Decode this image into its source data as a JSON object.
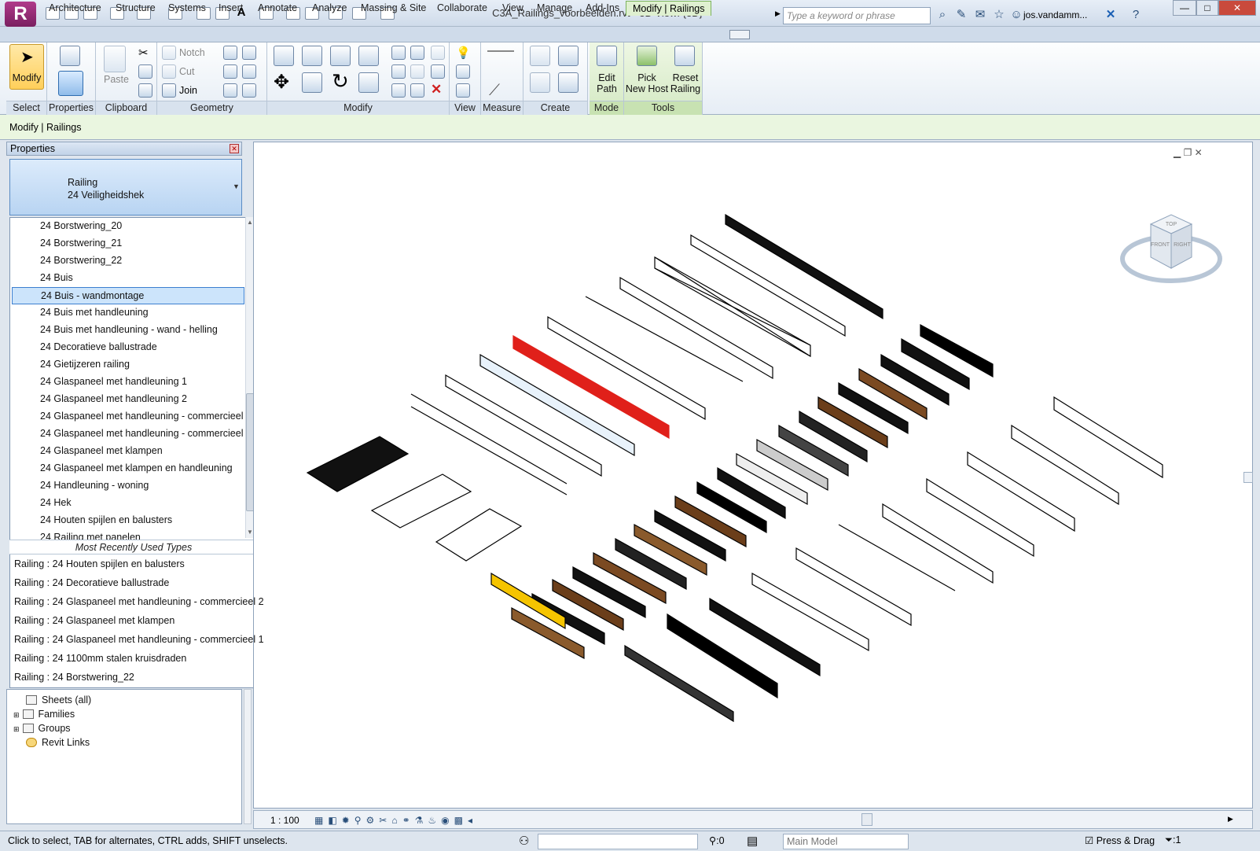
{
  "app": {
    "logo_letter": "R",
    "document_title": "C3A_Railings_voorbeelden.rvt - 3D View: {3D}",
    "search_placeholder": "Type a keyword or phrase",
    "username": "jos.vandamm..."
  },
  "tabs": [
    "Architecture",
    "Structure",
    "Systems",
    "Insert",
    "Annotate",
    "Analyze",
    "Massing & Site",
    "Collaborate",
    "View",
    "Manage",
    "Add-Ins",
    "Modify | Railings"
  ],
  "active_tab": "Modify | Railings",
  "ribbon": {
    "panels": {
      "select": "Select",
      "properties": "Properties",
      "clipboard": "Clipboard",
      "geometry": "Geometry",
      "modify": "Modify",
      "view": "View",
      "measure": "Measure",
      "create": "Create",
      "mode": "Mode",
      "tools": "Tools"
    },
    "buttons": {
      "modify": "Modify",
      "paste": "Paste",
      "notch": "Notch",
      "cut": "Cut",
      "join": "Join",
      "edit_path_1": "Edit",
      "edit_path_2": "Path",
      "pick_host_1": "Pick",
      "pick_host_2": "New Host",
      "reset_railing_1": "Reset",
      "reset_railing_2": "Railing"
    }
  },
  "context_bar": "Modify | Railings",
  "properties": {
    "header": "Properties",
    "type_family": "Railing",
    "type_name": "24 Veiligheidshek"
  },
  "type_list": [
    "24 Borstwering_20",
    "24 Borstwering_21",
    "24 Borstwering_22",
    "24 Buis",
    "24 Buis - wandmontage",
    "24 Buis met handleuning",
    "24 Buis met handleuning - wand - helling",
    "24 Decoratieve ballustrade",
    "24 Gietijzeren railing",
    "24 Glaspaneel met handleuning 1",
    "24 Glaspaneel met handleuning 2",
    "24 Glaspaneel met handleuning - commercieel 1",
    "24 Glaspaneel met handleuning - commercieel 2",
    "24 Glaspaneel met klampen",
    "24 Glaspaneel met klampen en handleuning",
    "24 Handleuning - woning",
    "24 Hek",
    "24 Houten spijlen en balusters",
    "24 Railing met panelen"
  ],
  "selected_type_index": 4,
  "mru": {
    "header": "Most Recently Used Types",
    "items": [
      "Railing : 24 Houten spijlen en balusters",
      "Railing : 24 Decoratieve ballustrade",
      "Railing : 24 Glaspaneel met handleuning - commercieel 2",
      "Railing : 24 Glaspaneel met klampen",
      "Railing : 24 Glaspaneel met handleuning - commercieel 1",
      "Railing : 24 1100mm stalen kruisdraden",
      "Railing : 24 Borstwering_22"
    ]
  },
  "project_browser": [
    "Sheets (all)",
    "Families",
    "Groups",
    "Revit Links"
  ],
  "viewport": {
    "scale": "1 : 100",
    "viewcube": {
      "top": "TOP",
      "front": "FRONT",
      "right": "RIGHT"
    }
  },
  "status": {
    "hint": "Click to select, TAB for alternates, CTRL adds, SHIFT unselects.",
    "selection_count": ":0",
    "model": "Main Model",
    "press_drag": "Press & Drag",
    "filter": ":1"
  },
  "colors": {
    "accent_green": "#7bb35c",
    "selection_blue": "#3c7fd0",
    "highlight_red": "#e0201a"
  }
}
